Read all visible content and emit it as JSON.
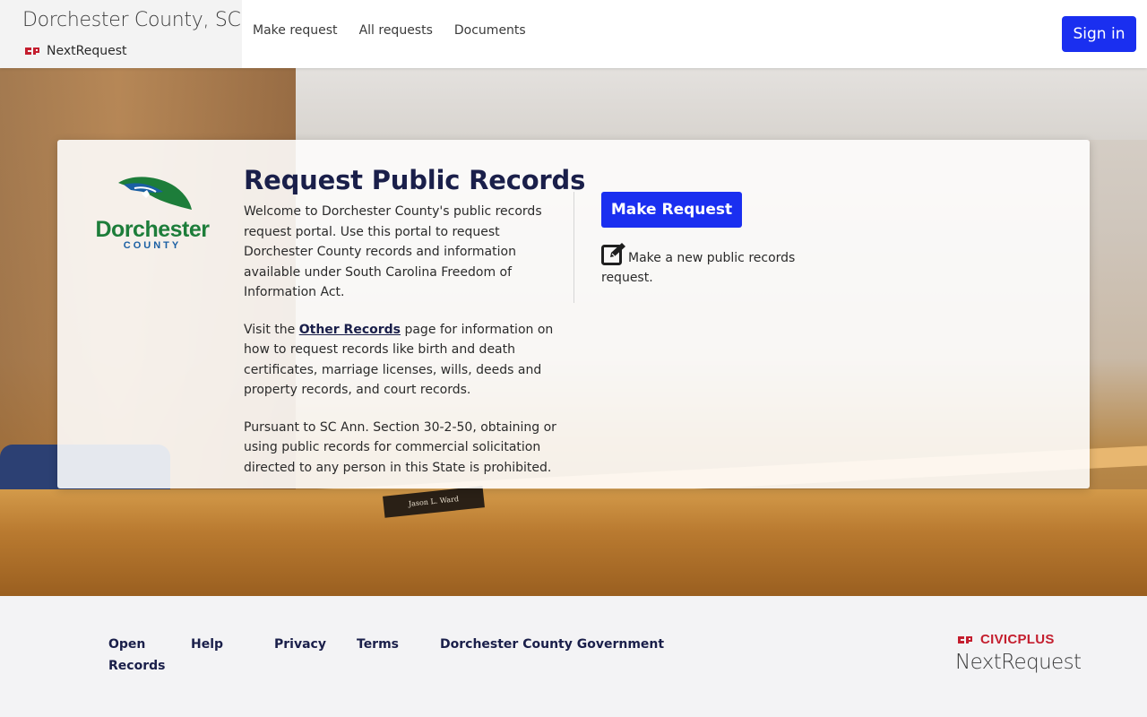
{
  "header": {
    "site_title": "Dorchester County, SC",
    "product_name": "NextRequest",
    "nav": [
      {
        "label": "Make request"
      },
      {
        "label": "All requests"
      },
      {
        "label": "Documents"
      }
    ],
    "signin_label": "Sign in"
  },
  "hero": {
    "nameplate_text": "Jason L. Ward"
  },
  "card": {
    "logo": {
      "name_line": "Dorchester",
      "county_line": "COUNTY"
    },
    "title": "Request Public Records",
    "paragraph1": "Welcome to Dorchester County's public records request portal. Use this portal to request Dorchester County records and information available under South Carolina Freedom of Information Act.",
    "paragraph2_prefix": "Visit the ",
    "paragraph2_link": "Other Records",
    "paragraph2_suffix": " page for information on how to request records like birth and death certificates, marriage licenses, wills, deeds and property records, and court records.",
    "paragraph3": "Pursuant to SC Ann. Section 30-2-50, obtaining or using public records for commercial solicitation directed to any person in this State is prohibited.",
    "make_request_button": "Make Request",
    "make_request_text": "Make a new public records request."
  },
  "footer": {
    "links": [
      {
        "label": "Open Records"
      },
      {
        "label": "Help"
      },
      {
        "label": "Privacy"
      },
      {
        "label": "Terms"
      },
      {
        "label": "Dorchester County Government"
      }
    ],
    "civicplus": "CIVICPLUS",
    "nextrequest": "NextRequest"
  },
  "colors": {
    "primary_button": "#1a2ff0",
    "heading": "#1a1f4a",
    "brand_red": "#c41e2e"
  },
  "icons": [
    "civicplus-logo-icon",
    "edit-icon",
    "dorchester-county-logo"
  ]
}
